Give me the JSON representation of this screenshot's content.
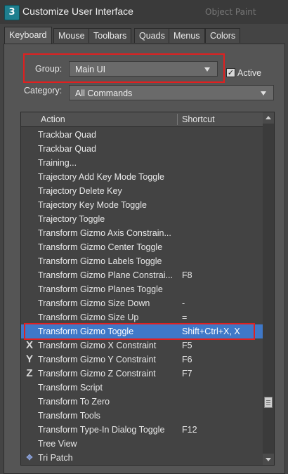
{
  "window": {
    "title": "Customize User Interface",
    "behind_text": "Object Paint",
    "app_icon": "3"
  },
  "tabs": [
    {
      "label": "Keyboard",
      "active": true
    },
    {
      "label": "Mouse",
      "active": false
    },
    {
      "label": "Toolbars",
      "active": false
    },
    {
      "label": "Quads",
      "active": false
    },
    {
      "label": "Menus",
      "active": false
    },
    {
      "label": "Colors",
      "active": false
    }
  ],
  "group": {
    "label": "Group:",
    "value": "Main UI"
  },
  "active_checkbox": {
    "label": "Active",
    "checked": true,
    "mark": "✓"
  },
  "category": {
    "label": "Category:",
    "value": "All Commands"
  },
  "list": {
    "columns": {
      "action": "Action",
      "shortcut": "Shortcut"
    },
    "rows": [
      {
        "action": "Trackbar Quad",
        "shortcut": "",
        "icon": ""
      },
      {
        "action": "Trackbar Quad",
        "shortcut": "",
        "icon": ""
      },
      {
        "action": "Training...",
        "shortcut": "",
        "icon": ""
      },
      {
        "action": "Trajectory Add Key Mode Toggle",
        "shortcut": "",
        "icon": ""
      },
      {
        "action": "Trajectory Delete Key",
        "shortcut": "",
        "icon": ""
      },
      {
        "action": "Trajectory Key Mode Toggle",
        "shortcut": "",
        "icon": ""
      },
      {
        "action": "Trajectory Toggle",
        "shortcut": "",
        "icon": ""
      },
      {
        "action": "Transform Gizmo Axis Constrain...",
        "shortcut": "",
        "icon": ""
      },
      {
        "action": "Transform Gizmo Center Toggle",
        "shortcut": "",
        "icon": ""
      },
      {
        "action": "Transform Gizmo Labels Toggle",
        "shortcut": "",
        "icon": ""
      },
      {
        "action": "Transform Gizmo Plane Constrai...",
        "shortcut": "F8",
        "icon": ""
      },
      {
        "action": "Transform Gizmo Planes Toggle",
        "shortcut": "",
        "icon": ""
      },
      {
        "action": "Transform Gizmo Size Down",
        "shortcut": "-",
        "icon": ""
      },
      {
        "action": "Transform Gizmo Size Up",
        "shortcut": "=",
        "icon": ""
      },
      {
        "action": "Transform Gizmo Toggle",
        "shortcut": "Shift+Ctrl+X, X",
        "icon": "",
        "selected": true
      },
      {
        "action": "Transform Gizmo X Constraint",
        "shortcut": "F5",
        "icon": "X"
      },
      {
        "action": "Transform Gizmo Y Constraint",
        "shortcut": "F6",
        "icon": "Y"
      },
      {
        "action": "Transform Gizmo Z Constraint",
        "shortcut": "F7",
        "icon": "Z"
      },
      {
        "action": "Transform Script",
        "shortcut": "",
        "icon": ""
      },
      {
        "action": "Transform To Zero",
        "shortcut": "",
        "icon": ""
      },
      {
        "action": "Transform Tools",
        "shortcut": "",
        "icon": ""
      },
      {
        "action": "Transform Type-In Dialog Toggle",
        "shortcut": "F12",
        "icon": ""
      },
      {
        "action": "Tree View",
        "shortcut": "",
        "icon": ""
      },
      {
        "action": "Tri Patch",
        "shortcut": "",
        "icon": "✥"
      }
    ]
  },
  "colors": {
    "selection": "#3f78c8",
    "annotation_red": "#e02020"
  }
}
